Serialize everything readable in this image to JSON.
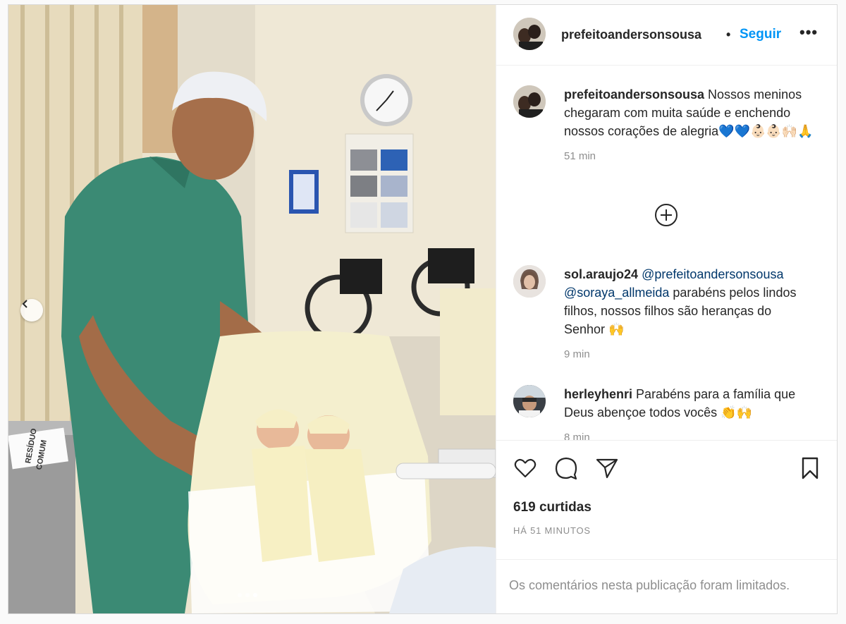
{
  "post": {
    "username": "prefeitoandersonsousa",
    "separator": "•",
    "follow_label": "Seguir",
    "more_icon": "more-options-icon",
    "more_glyph": "•••"
  },
  "caption": {
    "username": "prefeitoandersonsousa",
    "text": " Nossos meninos chegaram com muita saúde e enchendo nossos corações de alegria💙💙👶🏻👶🏻🙌🏻🙏",
    "time": "51 min"
  },
  "load_more_icon": "plus-circle-icon",
  "comments": [
    {
      "username": "sol.araujo24",
      "mention1": "@prefeitoandersonsousa",
      "mention2": "@soraya_allmeida",
      "text": " parabéns pelos lindos filhos, nossos filhos são heranças do Senhor 🙌",
      "time": "9 min"
    },
    {
      "username": "herleyhenri",
      "text": " Parabéns para a família que Deus abençoe todos vocês 👏🙌",
      "time": "8 min"
    }
  ],
  "actions": {
    "icons": [
      "heart-icon",
      "comment-icon",
      "share-icon",
      "bookmark-icon"
    ]
  },
  "likes_text": "619 curtidas",
  "posted_ago": "HÁ 51 MINUTOS",
  "comments_limited": "Os comentários nesta publicação foram limitados.",
  "media_overlays": {
    "bin_label_line1": "RESÍDUO",
    "bin_label_line2": "COMUM"
  },
  "carousel": {
    "slides": 3,
    "active": 3,
    "prev_icon": "chevron-left-icon"
  },
  "colors": {
    "link": "#0095f6",
    "mention": "#00376b",
    "muted": "#8e8e8e",
    "text": "#262626"
  }
}
